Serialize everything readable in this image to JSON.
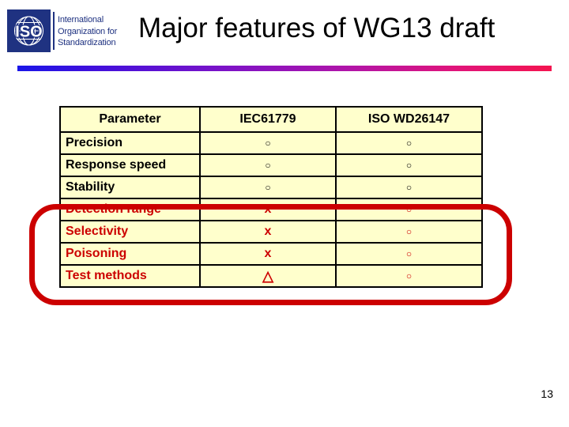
{
  "slide": {
    "title": "Major features of WG13 draft",
    "page_number": "13",
    "accent_red": "#cc0000",
    "logo_blue": "#1f3281",
    "table_fill": "#ffffcc",
    "gradient_from": "#1a16e8",
    "gradient_to": "#f4144f"
  },
  "logo": {
    "mark_text": "ISO",
    "org_line1": "International",
    "org_line2": "Organization for",
    "org_line3": "Standardization"
  },
  "table": {
    "headers": [
      "Parameter",
      "IEC61779",
      "ISO WD26147"
    ],
    "rows": [
      {
        "parameter": "Precision",
        "iec61779": "○",
        "iso_wd26147": "○",
        "emphasis": "normal"
      },
      {
        "parameter": "Response speed",
        "iec61779": "○",
        "iso_wd26147": "○",
        "emphasis": "normal"
      },
      {
        "parameter": "Stability",
        "iec61779": "○",
        "iso_wd26147": "○",
        "emphasis": "normal"
      },
      {
        "parameter": "Detection range",
        "iec61779": "x",
        "iso_wd26147": "○",
        "emphasis": "highlighted"
      },
      {
        "parameter": "Selectivity",
        "iec61779": "x",
        "iso_wd26147": "○",
        "emphasis": "highlighted"
      },
      {
        "parameter": "Poisoning",
        "iec61779": "x",
        "iso_wd26147": "○",
        "emphasis": "highlighted"
      },
      {
        "parameter": "Test methods",
        "iec61779": "△",
        "iso_wd26147": "○",
        "emphasis": "highlighted"
      }
    ]
  }
}
